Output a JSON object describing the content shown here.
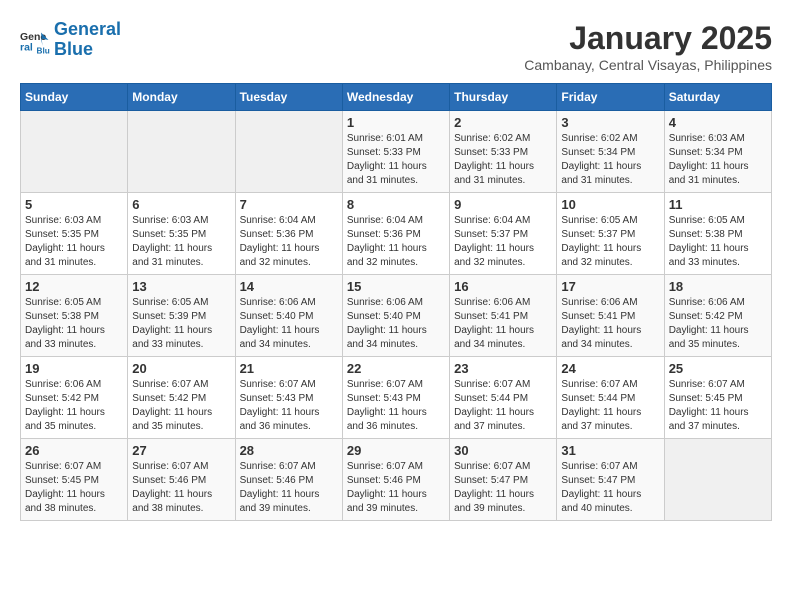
{
  "logo": {
    "line1": "General",
    "line2": "Blue"
  },
  "title": "January 2025",
  "subtitle": "Cambanay, Central Visayas, Philippines",
  "headers": [
    "Sunday",
    "Monday",
    "Tuesday",
    "Wednesday",
    "Thursday",
    "Friday",
    "Saturday"
  ],
  "weeks": [
    [
      {
        "day": "",
        "info": ""
      },
      {
        "day": "",
        "info": ""
      },
      {
        "day": "",
        "info": ""
      },
      {
        "day": "1",
        "info": "Sunrise: 6:01 AM\nSunset: 5:33 PM\nDaylight: 11 hours and 31 minutes."
      },
      {
        "day": "2",
        "info": "Sunrise: 6:02 AM\nSunset: 5:33 PM\nDaylight: 11 hours and 31 minutes."
      },
      {
        "day": "3",
        "info": "Sunrise: 6:02 AM\nSunset: 5:34 PM\nDaylight: 11 hours and 31 minutes."
      },
      {
        "day": "4",
        "info": "Sunrise: 6:03 AM\nSunset: 5:34 PM\nDaylight: 11 hours and 31 minutes."
      }
    ],
    [
      {
        "day": "5",
        "info": "Sunrise: 6:03 AM\nSunset: 5:35 PM\nDaylight: 11 hours and 31 minutes."
      },
      {
        "day": "6",
        "info": "Sunrise: 6:03 AM\nSunset: 5:35 PM\nDaylight: 11 hours and 31 minutes."
      },
      {
        "day": "7",
        "info": "Sunrise: 6:04 AM\nSunset: 5:36 PM\nDaylight: 11 hours and 32 minutes."
      },
      {
        "day": "8",
        "info": "Sunrise: 6:04 AM\nSunset: 5:36 PM\nDaylight: 11 hours and 32 minutes."
      },
      {
        "day": "9",
        "info": "Sunrise: 6:04 AM\nSunset: 5:37 PM\nDaylight: 11 hours and 32 minutes."
      },
      {
        "day": "10",
        "info": "Sunrise: 6:05 AM\nSunset: 5:37 PM\nDaylight: 11 hours and 32 minutes."
      },
      {
        "day": "11",
        "info": "Sunrise: 6:05 AM\nSunset: 5:38 PM\nDaylight: 11 hours and 33 minutes."
      }
    ],
    [
      {
        "day": "12",
        "info": "Sunrise: 6:05 AM\nSunset: 5:38 PM\nDaylight: 11 hours and 33 minutes."
      },
      {
        "day": "13",
        "info": "Sunrise: 6:05 AM\nSunset: 5:39 PM\nDaylight: 11 hours and 33 minutes."
      },
      {
        "day": "14",
        "info": "Sunrise: 6:06 AM\nSunset: 5:40 PM\nDaylight: 11 hours and 34 minutes."
      },
      {
        "day": "15",
        "info": "Sunrise: 6:06 AM\nSunset: 5:40 PM\nDaylight: 11 hours and 34 minutes."
      },
      {
        "day": "16",
        "info": "Sunrise: 6:06 AM\nSunset: 5:41 PM\nDaylight: 11 hours and 34 minutes."
      },
      {
        "day": "17",
        "info": "Sunrise: 6:06 AM\nSunset: 5:41 PM\nDaylight: 11 hours and 34 minutes."
      },
      {
        "day": "18",
        "info": "Sunrise: 6:06 AM\nSunset: 5:42 PM\nDaylight: 11 hours and 35 minutes."
      }
    ],
    [
      {
        "day": "19",
        "info": "Sunrise: 6:06 AM\nSunset: 5:42 PM\nDaylight: 11 hours and 35 minutes."
      },
      {
        "day": "20",
        "info": "Sunrise: 6:07 AM\nSunset: 5:42 PM\nDaylight: 11 hours and 35 minutes."
      },
      {
        "day": "21",
        "info": "Sunrise: 6:07 AM\nSunset: 5:43 PM\nDaylight: 11 hours and 36 minutes."
      },
      {
        "day": "22",
        "info": "Sunrise: 6:07 AM\nSunset: 5:43 PM\nDaylight: 11 hours and 36 minutes."
      },
      {
        "day": "23",
        "info": "Sunrise: 6:07 AM\nSunset: 5:44 PM\nDaylight: 11 hours and 37 minutes."
      },
      {
        "day": "24",
        "info": "Sunrise: 6:07 AM\nSunset: 5:44 PM\nDaylight: 11 hours and 37 minutes."
      },
      {
        "day": "25",
        "info": "Sunrise: 6:07 AM\nSunset: 5:45 PM\nDaylight: 11 hours and 37 minutes."
      }
    ],
    [
      {
        "day": "26",
        "info": "Sunrise: 6:07 AM\nSunset: 5:45 PM\nDaylight: 11 hours and 38 minutes."
      },
      {
        "day": "27",
        "info": "Sunrise: 6:07 AM\nSunset: 5:46 PM\nDaylight: 11 hours and 38 minutes."
      },
      {
        "day": "28",
        "info": "Sunrise: 6:07 AM\nSunset: 5:46 PM\nDaylight: 11 hours and 39 minutes."
      },
      {
        "day": "29",
        "info": "Sunrise: 6:07 AM\nSunset: 5:46 PM\nDaylight: 11 hours and 39 minutes."
      },
      {
        "day": "30",
        "info": "Sunrise: 6:07 AM\nSunset: 5:47 PM\nDaylight: 11 hours and 39 minutes."
      },
      {
        "day": "31",
        "info": "Sunrise: 6:07 AM\nSunset: 5:47 PM\nDaylight: 11 hours and 40 minutes."
      },
      {
        "day": "",
        "info": ""
      }
    ]
  ]
}
